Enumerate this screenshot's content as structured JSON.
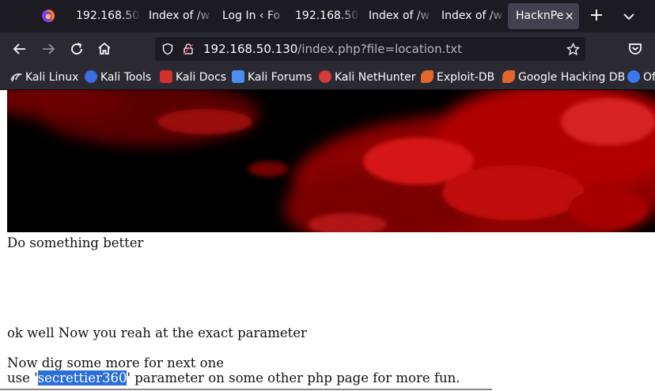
{
  "tabs": [
    {
      "title": "192.168.50",
      "active": false
    },
    {
      "title": "Index of /w",
      "active": false
    },
    {
      "title": "Log In ‹ Fo",
      "active": false
    },
    {
      "title": "192.168.50",
      "active": false
    },
    {
      "title": "Index of /w",
      "active": false
    },
    {
      "title": "Index of /w",
      "active": false
    },
    {
      "title": "HacknPe",
      "active": true
    }
  ],
  "new_tab_symbol": "+",
  "close_tab_symbol": "×",
  "url": {
    "host": "192.168.50.130",
    "path": "/index.php?file=location.txt"
  },
  "bookmarks": [
    {
      "label": "Kali Linux",
      "icon": "kali-dragon-icon",
      "color": "#dfe3ea"
    },
    {
      "label": "Kali Tools",
      "icon": "kali-tools-icon",
      "color": "#3b6ee0"
    },
    {
      "label": "Kali Docs",
      "icon": "kali-docs-icon",
      "color": "#d22f2f"
    },
    {
      "label": "Kali Forums",
      "icon": "kali-forums-icon",
      "color": "#4a8ef0"
    },
    {
      "label": "Kali NetHunter",
      "icon": "nethunter-icon",
      "color": "#d43a3a"
    },
    {
      "label": "Exploit-DB",
      "icon": "exploit-db-icon",
      "color": "#e0662a"
    },
    {
      "label": "Google Hacking DB",
      "icon": "ghdb-icon",
      "color": "#e0662a"
    },
    {
      "label": "Of",
      "icon": "offsec-icon",
      "color": "#3a78f2"
    }
  ],
  "page": {
    "line1": "Do something better",
    "line2": "ok well Now you reah at the exact parameter",
    "line3": "Now dig some more for next one",
    "line4_prefix": "use '",
    "line4_selected": "secrettier360",
    "line4_suffix": "' parameter on some other php page for more fun."
  }
}
